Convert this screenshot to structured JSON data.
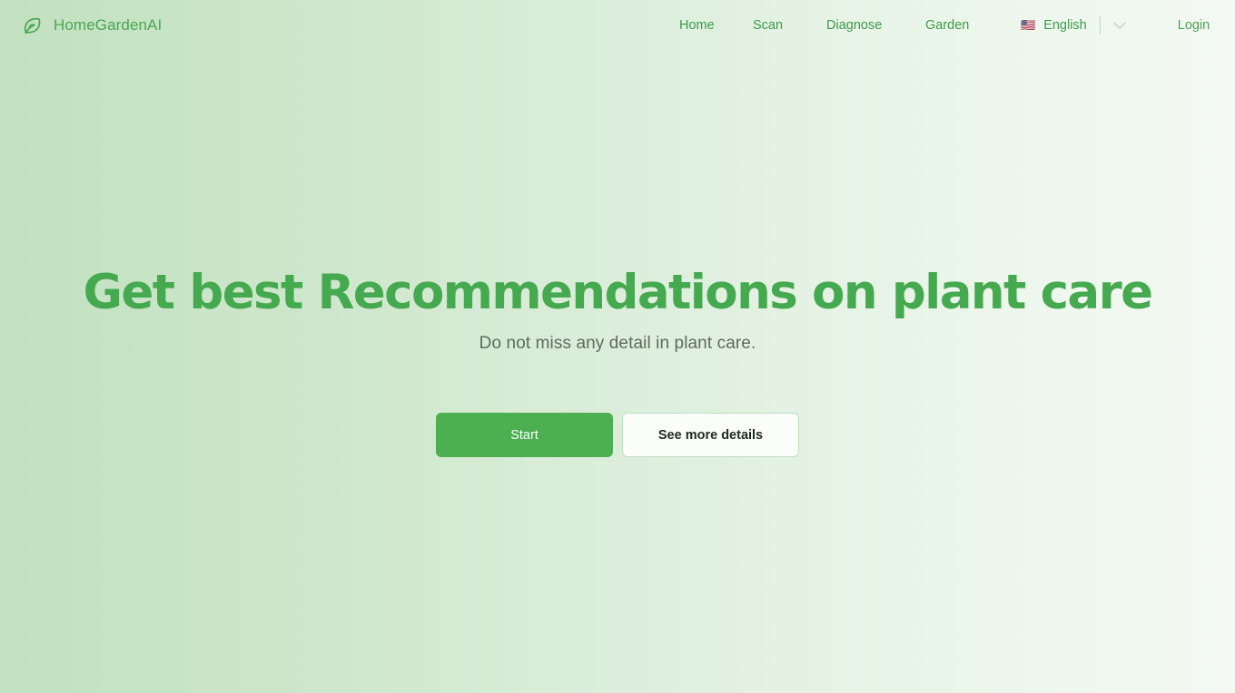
{
  "brand": {
    "name": "HomeGardenAI",
    "icon": "leaf-icon"
  },
  "nav": {
    "items": [
      {
        "label": "Home"
      },
      {
        "label": "Scan"
      },
      {
        "label": "Diagnose"
      },
      {
        "label": "Garden"
      }
    ]
  },
  "language": {
    "flag": "🇺🇸",
    "label": "English",
    "chevron": "chevron-down-icon"
  },
  "account": {
    "login_label": "Login"
  },
  "hero": {
    "title": "Get best Recommendations on plant care",
    "subtitle": "Do not miss any detail in plant care.",
    "primary_button": "Start",
    "secondary_button": "See more details"
  },
  "colors": {
    "brand_green": "#4aa852",
    "heading_green": "#45a94f",
    "primary_button_bg": "#4caf50",
    "secondary_button_border": "#bfdec1",
    "background_start": "#c2e1c0",
    "background_end": "#f3f9f2",
    "subtitle_text": "#5d6b5f"
  }
}
